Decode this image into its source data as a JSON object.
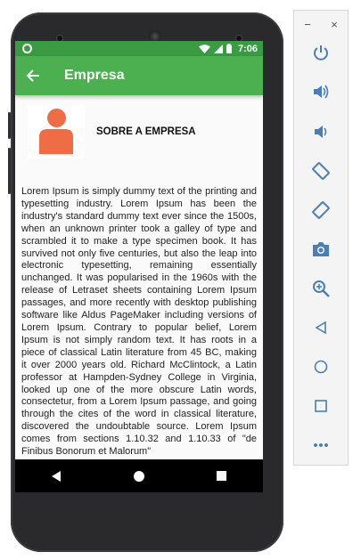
{
  "statusbar": {
    "time": "7:06"
  },
  "appbar": {
    "title": "Empresa"
  },
  "about": {
    "heading": "SOBRE A EMPRESA",
    "body": "Lorem Ipsum is simply dummy text of the printing and typesetting industry. Lorem Ipsum has been the industry's standard dummy text ever since the 1500s, when an unknown printer took a galley of type and scrambled it to make a type specimen book. It has survived not only five centuries, but also the leap into electronic typesetting, remaining essentially unchanged. It was popularised in the 1960s with the release of Letraset sheets containing Lorem Ipsum passages, and more recently with desktop publishing software like Aldus PageMaker including versions of Lorem Ipsum. Contrary to popular belief, Lorem Ipsum is not simply random text. It has roots in a piece of classical Latin literature from 45 BC, making it over 2000 years old. Richard McClintock, a Latin professor at Hampden-Sydney College in Virginia, looked up one of the more obscure Latin words, consectetur, from a Lorem Ipsum passage, and going through the cites of the word in classical literature, discovered the undoubtable source. Lorem Ipsum comes from sections 1.10.32 and 1.10.33 of \"de Finibus Bonorum et Malorum\""
  },
  "colors": {
    "statusbar": "#3a9b43",
    "appbar": "#4caf50",
    "avatar": "#ee6d45",
    "toolbar_icon": "#4a7fb5"
  },
  "icons": {
    "back": "arrow-back-icon",
    "avatar": "person-icon",
    "toolbar": [
      "power-icon",
      "volume-up-icon",
      "volume-down-icon",
      "rotate-left-icon",
      "rotate-right-icon",
      "camera-icon",
      "zoom-in-icon",
      "back-triangle-icon",
      "home-circle-icon",
      "overview-square-icon",
      "more-icon"
    ]
  }
}
